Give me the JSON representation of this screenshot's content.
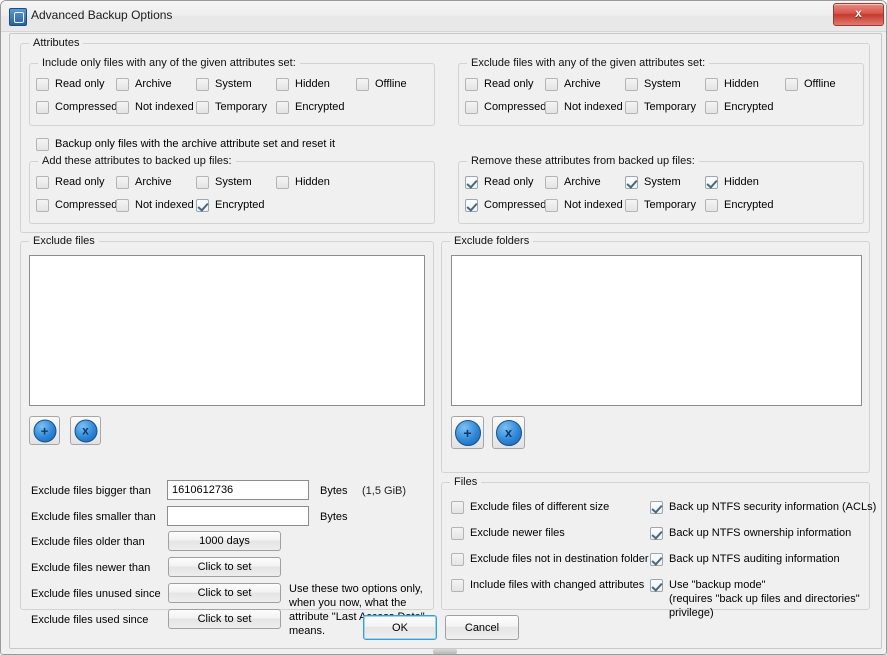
{
  "window": {
    "title": "Advanced Backup Options",
    "app_icon": "backup-app-icon",
    "close_glyph": "x"
  },
  "attributes_group": {
    "legend": "Attributes",
    "include_group": {
      "legend": "Include only files with any of the given attributes set:",
      "row1": [
        {
          "label": "Read only",
          "checked": false
        },
        {
          "label": "Archive",
          "checked": false
        },
        {
          "label": "System",
          "checked": false
        },
        {
          "label": "Hidden",
          "checked": false
        },
        {
          "label": "Offline",
          "checked": false
        }
      ],
      "row2": [
        {
          "label": "Compressed",
          "checked": false
        },
        {
          "label": "Not indexed",
          "checked": false
        },
        {
          "label": "Temporary",
          "checked": false
        },
        {
          "label": "Encrypted",
          "checked": false
        }
      ]
    },
    "exclude_group": {
      "legend": "Exclude files with any of the given attributes set:",
      "row1": [
        {
          "label": "Read only",
          "checked": false
        },
        {
          "label": "Archive",
          "checked": false
        },
        {
          "label": "System",
          "checked": false
        },
        {
          "label": "Hidden",
          "checked": false
        },
        {
          "label": "Offline",
          "checked": false
        }
      ],
      "row2": [
        {
          "label": "Compressed",
          "checked": false
        },
        {
          "label": "Not indexed",
          "checked": false
        },
        {
          "label": "Temporary",
          "checked": false
        },
        {
          "label": "Encrypted",
          "checked": false
        }
      ]
    },
    "archive_only": {
      "label": "Backup only files with the archive attribute set and reset it",
      "checked": false
    },
    "add_group": {
      "legend": "Add these attributes to backed up files:",
      "row1": [
        {
          "label": "Read only",
          "checked": false
        },
        {
          "label": "Archive",
          "checked": false
        },
        {
          "label": "System",
          "checked": false
        },
        {
          "label": "Hidden",
          "checked": false
        }
      ],
      "row2": [
        {
          "label": "Compressed",
          "checked": false
        },
        {
          "label": "Not indexed",
          "checked": false
        },
        {
          "label": "Encrypted",
          "checked": true
        }
      ]
    },
    "remove_group": {
      "legend": "Remove these attributes from backed up files:",
      "row1": [
        {
          "label": "Read only",
          "checked": true
        },
        {
          "label": "Archive",
          "checked": false
        },
        {
          "label": "System",
          "checked": true
        },
        {
          "label": "Hidden",
          "checked": true
        }
      ],
      "row2": [
        {
          "label": "Compressed",
          "checked": true
        },
        {
          "label": "Not indexed",
          "checked": false
        },
        {
          "label": "Temporary",
          "checked": false
        },
        {
          "label": "Encrypted",
          "checked": false
        }
      ]
    }
  },
  "exclude_files": {
    "legend": "Exclude files",
    "list_items": [],
    "add_button": "+",
    "remove_button": "x",
    "rows": [
      {
        "label": "Exclude files bigger than",
        "control": "input",
        "value": "1610612736",
        "unit": "Bytes",
        "hint": "(1,5 GiB)"
      },
      {
        "label": "Exclude files smaller than",
        "control": "input",
        "value": "",
        "unit": "Bytes",
        "hint": ""
      },
      {
        "label": "Exclude files older than",
        "control": "button",
        "value": "1000 days"
      },
      {
        "label": "Exclude files newer than",
        "control": "button",
        "value": "Click to set"
      },
      {
        "label": "Exclude files unused since",
        "control": "button",
        "value": "Click to set"
      },
      {
        "label": "Exclude files used since",
        "control": "button",
        "value": "Click to set"
      }
    ],
    "note": "Use these two options only, when you now, what the attribute \"Last Access Date\" means."
  },
  "exclude_folders": {
    "legend": "Exclude folders",
    "list_items": [],
    "add_button": "+",
    "remove_button": "x"
  },
  "files_group": {
    "legend": "Files",
    "left_options": [
      {
        "label": "Exclude files of different size",
        "checked": false
      },
      {
        "label": "Exclude newer files",
        "checked": false
      },
      {
        "label": "Exclude files not in destination folder",
        "checked": false
      },
      {
        "label": "Include files with changed attributes",
        "checked": false
      }
    ],
    "right_options": [
      {
        "label": "Back up NTFS security information (ACLs)",
        "checked": true
      },
      {
        "label": "Back up NTFS ownership information",
        "checked": true
      },
      {
        "label": "Back up NTFS auditing information",
        "checked": true
      },
      {
        "label": "Use \"backup mode\"",
        "checked": true
      }
    ],
    "backup_mode_note": "(requires \"back up files and directories\"\nprivilege)"
  },
  "footer": {
    "ok_label": "OK",
    "cancel_label": "Cancel"
  }
}
